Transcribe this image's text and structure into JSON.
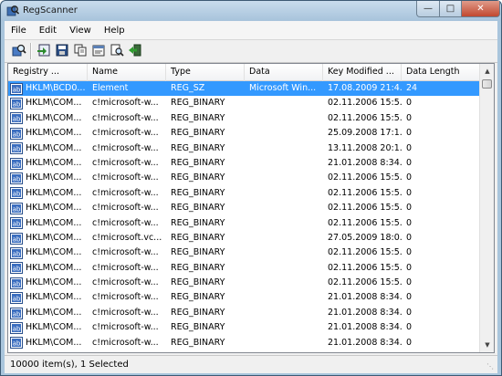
{
  "window": {
    "title": "RegScanner"
  },
  "menu": [
    "File",
    "Edit",
    "View",
    "Help"
  ],
  "toolbar": {
    "buttons": [
      "scan-icon",
      "export-icon",
      "save-icon",
      "copy-icon",
      "properties-icon",
      "find-icon",
      "exit-icon"
    ]
  },
  "columns": [
    "Registry ...",
    "Name",
    "Type",
    "Data",
    "Key Modified ...",
    "Data Length"
  ],
  "rows": [
    {
      "key": "HKLM\\BCD0...",
      "name": "Element",
      "type": "REG_SZ",
      "data": "Microsoft Win...",
      "modified": "17.08.2009 21:4...",
      "length": "24",
      "selected": true
    },
    {
      "key": "HKLM\\COM...",
      "name": "c!microsoft-w...",
      "type": "REG_BINARY",
      "data": "",
      "modified": "02.11.2006 15:5...",
      "length": "0"
    },
    {
      "key": "HKLM\\COM...",
      "name": "c!microsoft-w...",
      "type": "REG_BINARY",
      "data": "",
      "modified": "02.11.2006 15:5...",
      "length": "0"
    },
    {
      "key": "HKLM\\COM...",
      "name": "c!microsoft-w...",
      "type": "REG_BINARY",
      "data": "",
      "modified": "25.09.2008 17:1...",
      "length": "0"
    },
    {
      "key": "HKLM\\COM...",
      "name": "c!microsoft-w...",
      "type": "REG_BINARY",
      "data": "",
      "modified": "13.11.2008 20:1...",
      "length": "0"
    },
    {
      "key": "HKLM\\COM...",
      "name": "c!microsoft-w...",
      "type": "REG_BINARY",
      "data": "",
      "modified": "21.01.2008 8:34...",
      "length": "0"
    },
    {
      "key": "HKLM\\COM...",
      "name": "c!microsoft-w...",
      "type": "REG_BINARY",
      "data": "",
      "modified": "02.11.2006 15:5...",
      "length": "0"
    },
    {
      "key": "HKLM\\COM...",
      "name": "c!microsoft-w...",
      "type": "REG_BINARY",
      "data": "",
      "modified": "02.11.2006 15:5...",
      "length": "0"
    },
    {
      "key": "HKLM\\COM...",
      "name": "c!microsoft-w...",
      "type": "REG_BINARY",
      "data": "",
      "modified": "02.11.2006 15:5...",
      "length": "0"
    },
    {
      "key": "HKLM\\COM...",
      "name": "c!microsoft-w...",
      "type": "REG_BINARY",
      "data": "",
      "modified": "02.11.2006 15:5...",
      "length": "0"
    },
    {
      "key": "HKLM\\COM...",
      "name": "c!microsoft.vc...",
      "type": "REG_BINARY",
      "data": "",
      "modified": "27.05.2009 18:0...",
      "length": "0"
    },
    {
      "key": "HKLM\\COM...",
      "name": "c!microsoft-w...",
      "type": "REG_BINARY",
      "data": "",
      "modified": "02.11.2006 15:5...",
      "length": "0"
    },
    {
      "key": "HKLM\\COM...",
      "name": "c!microsoft-w...",
      "type": "REG_BINARY",
      "data": "",
      "modified": "02.11.2006 15:5...",
      "length": "0"
    },
    {
      "key": "HKLM\\COM...",
      "name": "c!microsoft-w...",
      "type": "REG_BINARY",
      "data": "",
      "modified": "02.11.2006 15:5...",
      "length": "0"
    },
    {
      "key": "HKLM\\COM...",
      "name": "c!microsoft-w...",
      "type": "REG_BINARY",
      "data": "",
      "modified": "21.01.2008 8:34...",
      "length": "0"
    },
    {
      "key": "HKLM\\COM...",
      "name": "c!microsoft-w...",
      "type": "REG_BINARY",
      "data": "",
      "modified": "21.01.2008 8:34...",
      "length": "0"
    },
    {
      "key": "HKLM\\COM...",
      "name": "c!microsoft-w...",
      "type": "REG_BINARY",
      "data": "",
      "modified": "21.01.2008 8:34...",
      "length": "0"
    },
    {
      "key": "HKLM\\COM...",
      "name": "c!microsoft-w...",
      "type": "REG_BINARY",
      "data": "",
      "modified": "21.01.2008 8:34...",
      "length": "0"
    }
  ],
  "status": {
    "text": "10000 item(s), 1 Selected"
  },
  "colors": {
    "selection": "#3399ff",
    "title_gradient_top": "#c9dced",
    "close_button": "#c1482f"
  }
}
